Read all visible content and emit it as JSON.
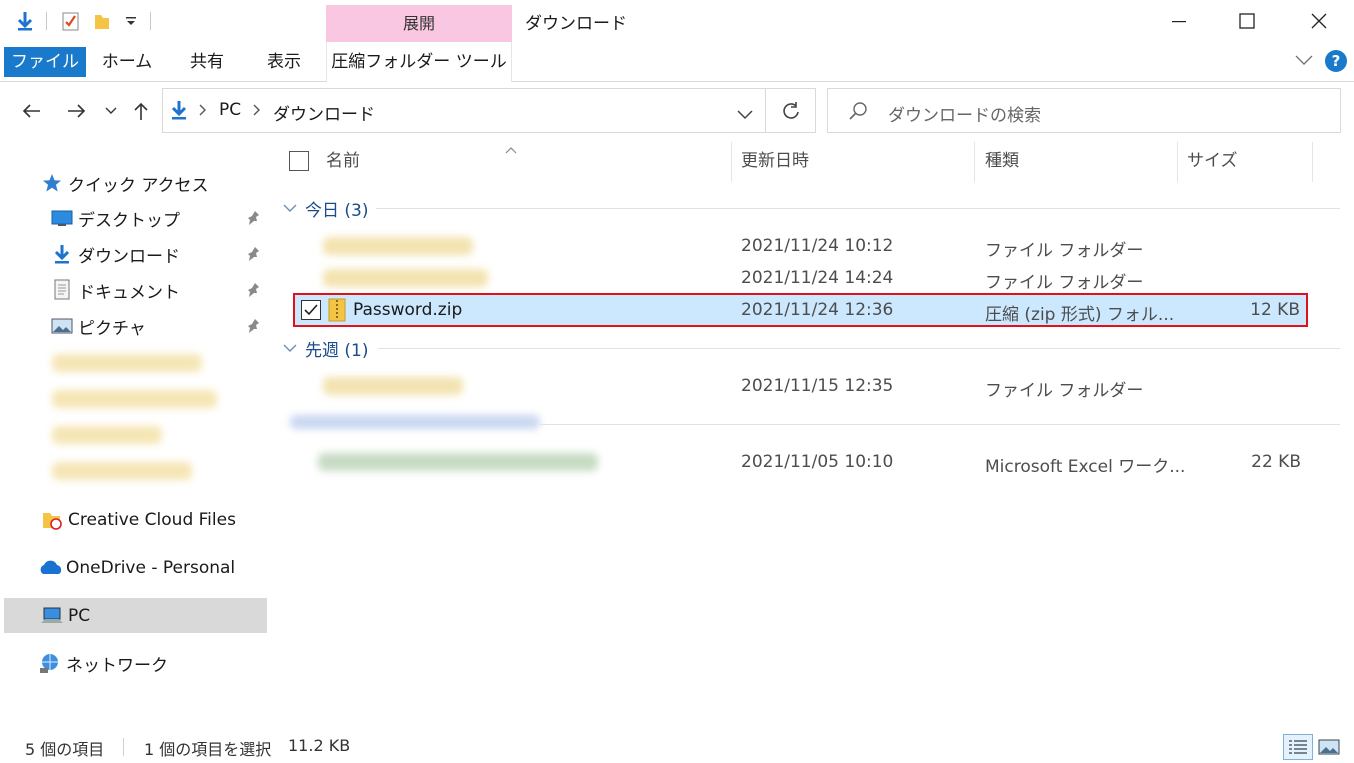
{
  "window": {
    "title": "ダウンロード",
    "context_tab_group": "展開"
  },
  "ribbon": {
    "tabs": [
      "ファイル",
      "ホーム",
      "共有",
      "表示",
      "圧縮フォルダー ツール"
    ]
  },
  "address": {
    "root": "PC",
    "current": "ダウンロード",
    "search_placeholder": "ダウンロードの検索"
  },
  "nav": {
    "quick_access": "クイック アクセス",
    "pinned": [
      "デスクトップ",
      "ダウンロード",
      "ドキュメント",
      "ピクチャ"
    ],
    "creative_cloud": "Creative Cloud Files",
    "onedrive": "OneDrive - Personal",
    "pc": "PC",
    "network": "ネットワーク"
  },
  "columns": {
    "name": "名前",
    "modified": "更新日時",
    "type": "種類",
    "size": "サイズ"
  },
  "groups": {
    "today": "今日 (3)",
    "last_week": "先週 (1)"
  },
  "rows": [
    {
      "name": "",
      "modified": "2021/11/24 10:12",
      "type": "ファイル フォルダー",
      "size": ""
    },
    {
      "name": "",
      "modified": "2021/11/24 14:24",
      "type": "ファイル フォルダー",
      "size": ""
    },
    {
      "name": "Password.zip",
      "modified": "2021/11/24 12:36",
      "type": "圧縮 (zip 形式) フォル...",
      "size": "12 KB"
    },
    {
      "name": "",
      "modified": "2021/11/15 12:35",
      "type": "ファイル フォルダー",
      "size": ""
    },
    {
      "name": "",
      "modified": "2021/11/05 10:10",
      "type": "Microsoft Excel ワーク...",
      "size": "22 KB"
    }
  ],
  "status": {
    "count": "5 個の項目",
    "selected": "1 個の項目を選択",
    "selected_size": "11.2 KB"
  },
  "colors": {
    "accent": "#1979ca",
    "selection": "#cce8ff",
    "highlight_border": "#e0111a",
    "context_tab": "#f9c7e1"
  }
}
